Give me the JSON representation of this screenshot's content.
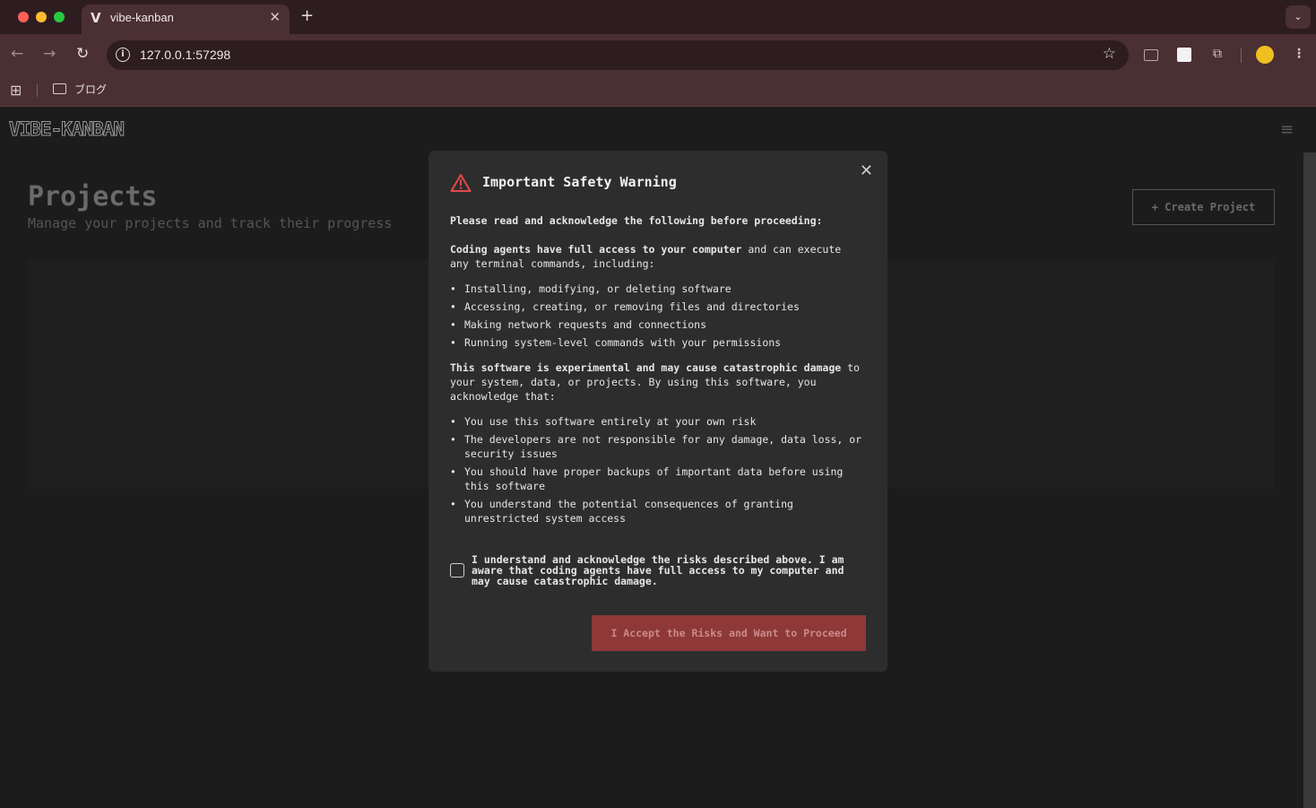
{
  "browser": {
    "tab_title": "vibe-kanban",
    "tab_favicon": "V",
    "url": "127.0.0.1:57298",
    "bookmark_folder": "ブログ"
  },
  "app": {
    "logo": "VIBE-KANBAN",
    "page_title": "Projects",
    "page_subtitle": "Manage your projects and track their progress",
    "create_button": "Create Project"
  },
  "modal": {
    "title": "Important Safety Warning",
    "intro": "Please read and acknowledge the following before proceeding:",
    "access_bold": "Coding agents have full access to your computer",
    "access_rest": " and can execute any terminal commands, including:",
    "capabilities": [
      "Installing, modifying, or deleting software",
      "Accessing, creating, or removing files and directories",
      "Making network requests and connections",
      "Running system-level commands with your permissions"
    ],
    "experimental_bold": "This software is experimental and may cause catastrophic damage",
    "experimental_rest": " to your system, data, or projects. By using this software, you acknowledge that:",
    "acknowledgements": [
      "You use this software entirely at your own risk",
      "The developers are not responsible for any damage, data loss, or security issues",
      "You should have proper backups of important data before using this software",
      "You understand the potential consequences of granting unrestricted system access"
    ],
    "checkbox_label": "I understand and acknowledge the risks described above. I am aware that coding agents have full access to my computer and may cause catastrophic damage.",
    "checkbox_checked": false,
    "accept_button": "I Accept the Risks and Want to Proceed"
  },
  "colors": {
    "accept_button_bg": "#8e3838",
    "warning_icon": "#e5484d",
    "modal_bg": "#2d2d2d",
    "page_bg": "#1c1c1c"
  }
}
